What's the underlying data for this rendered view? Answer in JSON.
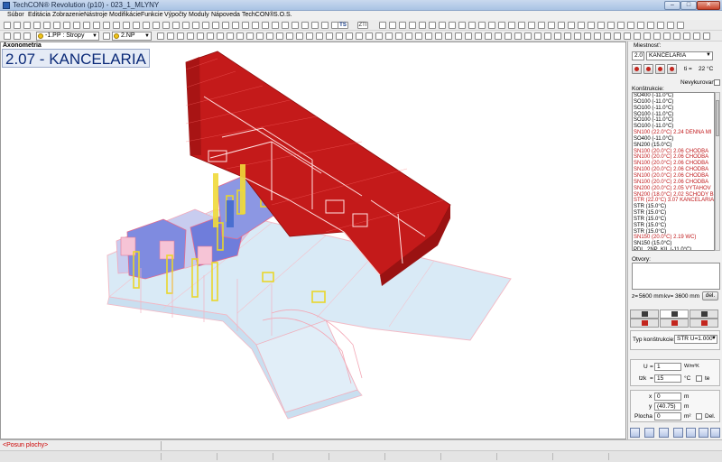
{
  "window": {
    "title": "TechCON® Revolution  (p10) - 023_1_MLYNY",
    "min_label": "–",
    "max_label": "□",
    "close_label": "✕"
  },
  "menu": {
    "items": [
      "Súbor",
      "Editácia",
      "Zobrazenie",
      "Nástroje",
      "Modifikácie",
      "Funkcie",
      "Výpočty",
      "Moduly",
      "Nápoveda",
      "TechCON®",
      "S.O.S."
    ]
  },
  "toolbar": {
    "floor_combo": "-1.PP : Stropy",
    "level_combo": "2.NP",
    "text_labels": [
      "TS",
      "ZTI"
    ]
  },
  "viewport": {
    "view_label": "Axonometria",
    "room_title": "2.07 - KANCELARIA"
  },
  "panel": {
    "room_label": "Miestnosť:",
    "room_code": "2.07",
    "room_name": "KANCELARIA",
    "temp_symbol": "ti =",
    "temp_value": "22",
    "temp_unit": "°C",
    "unheated_label": "Nevykurovaná",
    "constructions_label": "Konštrukcie:",
    "constructions": [
      {
        "text": "SO400  (-11.0°C)",
        "red": false
      },
      {
        "text": "SO100  (-11.0°C)",
        "red": false
      },
      {
        "text": "SO100  (-11.0°C)",
        "red": false
      },
      {
        "text": "SO100  (-11.0°C)",
        "red": false
      },
      {
        "text": "SO100  (-11.0°C)",
        "red": false
      },
      {
        "text": "SO100  (-11.0°C)",
        "red": false
      },
      {
        "text": "SN100  (22.0°C)   2.24 DENNA MI",
        "red": true
      },
      {
        "text": "SO400  (-11.0°C)",
        "red": false
      },
      {
        "text": "SN200  (15.0°C)",
        "red": false
      },
      {
        "text": "SN100  (20.0°C)   2.06 CHODBA",
        "red": true
      },
      {
        "text": "SN100  (20.0°C)   2.06 CHODBA",
        "red": true
      },
      {
        "text": "SN100  (20.0°C)   2.06 CHODBA",
        "red": true
      },
      {
        "text": "SN100  (20.0°C)   2.06 CHODBA",
        "red": true
      },
      {
        "text": "SN100  (20.0°C)   2.06 CHODBA",
        "red": true
      },
      {
        "text": "SN100  (20.0°C)   2.06 CHODBA",
        "red": true
      },
      {
        "text": "SN200  (20.0°C)   2.05 VYTAHOV",
        "red": true
      },
      {
        "text": "SN200  (18.0°C)   2.02 SCHODY B",
        "red": true
      },
      {
        "text": "STR  (22.0°C)   3.07 KANCELARIA",
        "red": true
      },
      {
        "text": "STR  (15.0°C)",
        "red": false
      },
      {
        "text": "STR  (15.0°C)",
        "red": false
      },
      {
        "text": "STR  (15.0°C)",
        "red": false
      },
      {
        "text": "STR  (15.0°C)",
        "red": false
      },
      {
        "text": "STR  (15.0°C)",
        "red": false
      },
      {
        "text": "SN150  (20.0°C)   2.19 WC)",
        "red": true
      },
      {
        "text": "SN150  (15.0°C)",
        "red": false
      },
      {
        "text": "PDL_2NP_KIL  (-11.0°C)",
        "red": false
      }
    ],
    "openings_label": "Otvory:",
    "z_label": "z=",
    "z_value": "5600 mm",
    "kv_label": "kv=",
    "kv_value": "3600 mm",
    "del_button": "del.",
    "type_label": "Typ konštrukcie:",
    "type_value": "STR U=1.000",
    "u_label": "U",
    "u_eq": "=",
    "u_value": "1",
    "u_unit": "W/m²K",
    "tzk_label": "tzk",
    "tzk_eq": "=",
    "tzk_value": "15",
    "tzk_unit": "°C",
    "te_label": "te",
    "x_label": "x",
    "x_value": "0",
    "x_unit": "m",
    "y_label": "y",
    "y_value": "(40.75)",
    "y_unit": "m",
    "area_label": "Plocha",
    "area_value": "0",
    "area_unit": "m²",
    "del_check_label": "Del."
  },
  "status": {
    "message": "<Posun plochy>"
  }
}
